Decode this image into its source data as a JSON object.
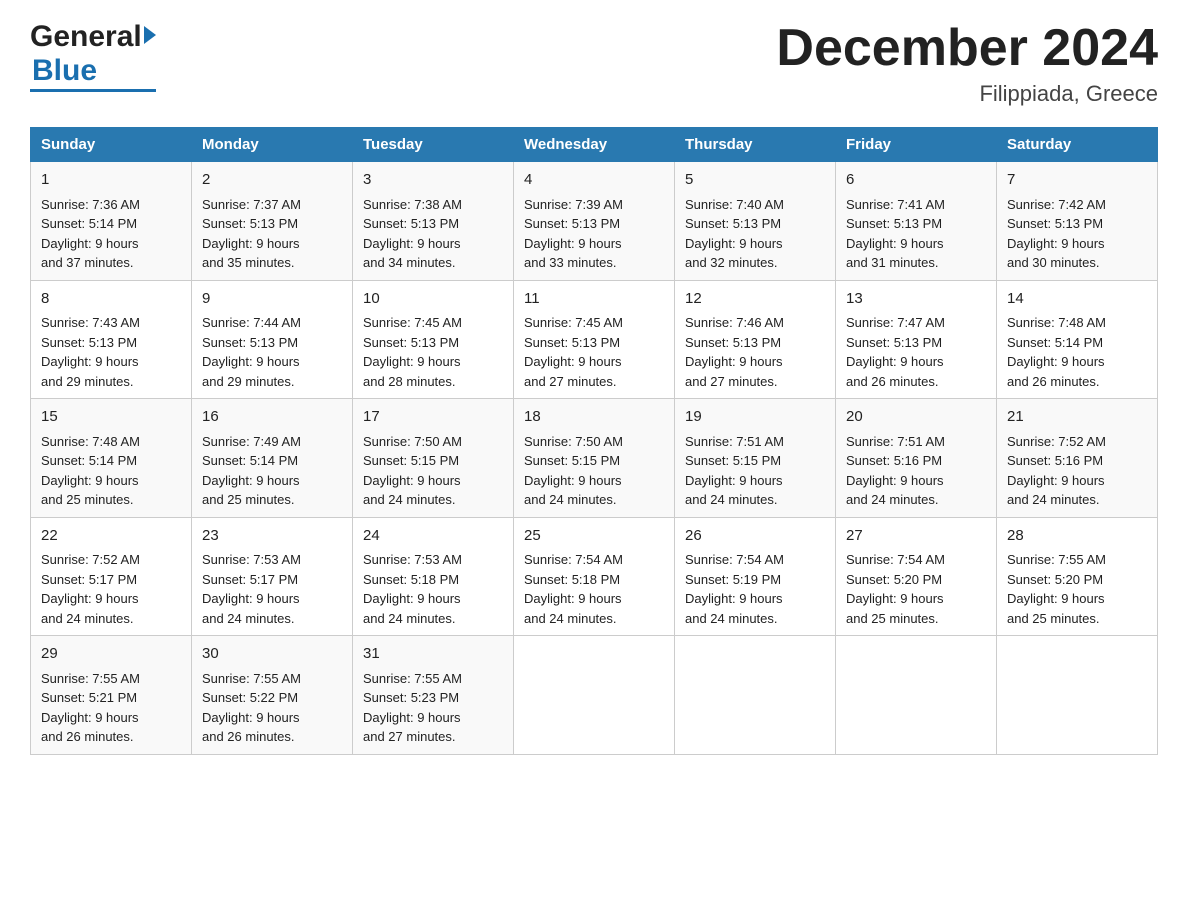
{
  "header": {
    "logo_general": "General",
    "logo_blue": "Blue",
    "month_year": "December 2024",
    "location": "Filippiada, Greece"
  },
  "columns": [
    "Sunday",
    "Monday",
    "Tuesday",
    "Wednesday",
    "Thursday",
    "Friday",
    "Saturday"
  ],
  "weeks": [
    [
      {
        "day": "1",
        "sunrise": "7:36 AM",
        "sunset": "5:14 PM",
        "daylight": "9 hours and 37 minutes."
      },
      {
        "day": "2",
        "sunrise": "7:37 AM",
        "sunset": "5:13 PM",
        "daylight": "9 hours and 35 minutes."
      },
      {
        "day": "3",
        "sunrise": "7:38 AM",
        "sunset": "5:13 PM",
        "daylight": "9 hours and 34 minutes."
      },
      {
        "day": "4",
        "sunrise": "7:39 AM",
        "sunset": "5:13 PM",
        "daylight": "9 hours and 33 minutes."
      },
      {
        "day": "5",
        "sunrise": "7:40 AM",
        "sunset": "5:13 PM",
        "daylight": "9 hours and 32 minutes."
      },
      {
        "day": "6",
        "sunrise": "7:41 AM",
        "sunset": "5:13 PM",
        "daylight": "9 hours and 31 minutes."
      },
      {
        "day": "7",
        "sunrise": "7:42 AM",
        "sunset": "5:13 PM",
        "daylight": "9 hours and 30 minutes."
      }
    ],
    [
      {
        "day": "8",
        "sunrise": "7:43 AM",
        "sunset": "5:13 PM",
        "daylight": "9 hours and 29 minutes."
      },
      {
        "day": "9",
        "sunrise": "7:44 AM",
        "sunset": "5:13 PM",
        "daylight": "9 hours and 29 minutes."
      },
      {
        "day": "10",
        "sunrise": "7:45 AM",
        "sunset": "5:13 PM",
        "daylight": "9 hours and 28 minutes."
      },
      {
        "day": "11",
        "sunrise": "7:45 AM",
        "sunset": "5:13 PM",
        "daylight": "9 hours and 27 minutes."
      },
      {
        "day": "12",
        "sunrise": "7:46 AM",
        "sunset": "5:13 PM",
        "daylight": "9 hours and 27 minutes."
      },
      {
        "day": "13",
        "sunrise": "7:47 AM",
        "sunset": "5:13 PM",
        "daylight": "9 hours and 26 minutes."
      },
      {
        "day": "14",
        "sunrise": "7:48 AM",
        "sunset": "5:14 PM",
        "daylight": "9 hours and 26 minutes."
      }
    ],
    [
      {
        "day": "15",
        "sunrise": "7:48 AM",
        "sunset": "5:14 PM",
        "daylight": "9 hours and 25 minutes."
      },
      {
        "day": "16",
        "sunrise": "7:49 AM",
        "sunset": "5:14 PM",
        "daylight": "9 hours and 25 minutes."
      },
      {
        "day": "17",
        "sunrise": "7:50 AM",
        "sunset": "5:15 PM",
        "daylight": "9 hours and 24 minutes."
      },
      {
        "day": "18",
        "sunrise": "7:50 AM",
        "sunset": "5:15 PM",
        "daylight": "9 hours and 24 minutes."
      },
      {
        "day": "19",
        "sunrise": "7:51 AM",
        "sunset": "5:15 PM",
        "daylight": "9 hours and 24 minutes."
      },
      {
        "day": "20",
        "sunrise": "7:51 AM",
        "sunset": "5:16 PM",
        "daylight": "9 hours and 24 minutes."
      },
      {
        "day": "21",
        "sunrise": "7:52 AM",
        "sunset": "5:16 PM",
        "daylight": "9 hours and 24 minutes."
      }
    ],
    [
      {
        "day": "22",
        "sunrise": "7:52 AM",
        "sunset": "5:17 PM",
        "daylight": "9 hours and 24 minutes."
      },
      {
        "day": "23",
        "sunrise": "7:53 AM",
        "sunset": "5:17 PM",
        "daylight": "9 hours and 24 minutes."
      },
      {
        "day": "24",
        "sunrise": "7:53 AM",
        "sunset": "5:18 PM",
        "daylight": "9 hours and 24 minutes."
      },
      {
        "day": "25",
        "sunrise": "7:54 AM",
        "sunset": "5:18 PM",
        "daylight": "9 hours and 24 minutes."
      },
      {
        "day": "26",
        "sunrise": "7:54 AM",
        "sunset": "5:19 PM",
        "daylight": "9 hours and 24 minutes."
      },
      {
        "day": "27",
        "sunrise": "7:54 AM",
        "sunset": "5:20 PM",
        "daylight": "9 hours and 25 minutes."
      },
      {
        "day": "28",
        "sunrise": "7:55 AM",
        "sunset": "5:20 PM",
        "daylight": "9 hours and 25 minutes."
      }
    ],
    [
      {
        "day": "29",
        "sunrise": "7:55 AM",
        "sunset": "5:21 PM",
        "daylight": "9 hours and 26 minutes."
      },
      {
        "day": "30",
        "sunrise": "7:55 AM",
        "sunset": "5:22 PM",
        "daylight": "9 hours and 26 minutes."
      },
      {
        "day": "31",
        "sunrise": "7:55 AM",
        "sunset": "5:23 PM",
        "daylight": "9 hours and 27 minutes."
      },
      null,
      null,
      null,
      null
    ]
  ],
  "labels": {
    "sunrise": "Sunrise:",
    "sunset": "Sunset:",
    "daylight": "Daylight:"
  }
}
